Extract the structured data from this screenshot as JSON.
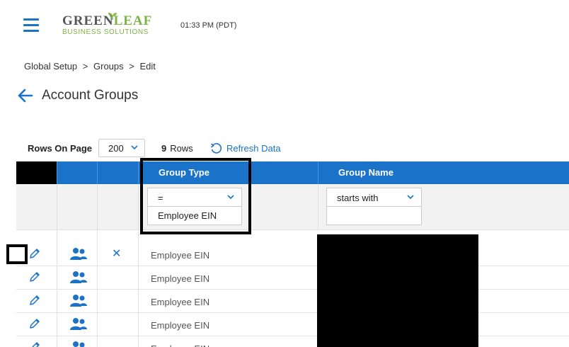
{
  "header": {
    "menu_icon": "hamburger-icon",
    "logo": {
      "line1_a": "GREEN",
      "line1_b": "LEAF",
      "line2": "BUSINESS SOLUTIONS"
    },
    "time": "01:33 PM (PDT)"
  },
  "breadcrumb": [
    "Global Setup",
    ">",
    "Groups",
    ">",
    "Edit"
  ],
  "page": {
    "title": "Account Groups",
    "back_icon": "arrow-left-icon"
  },
  "controls": {
    "rows_on_page_label": "Rows On Page",
    "rows_on_page_value": "200",
    "row_count": "9",
    "row_count_label": "Rows",
    "refresh_label": "Refresh Data"
  },
  "table": {
    "columns": [
      "",
      "",
      "",
      "Group Type",
      "Group Name"
    ],
    "filters": {
      "group_type_operator": "=",
      "group_type_value": "Employee EIN",
      "group_name_operator": "starts with",
      "group_name_value": ""
    },
    "rows": [
      {
        "group_type": "Employee EIN"
      },
      {
        "group_type": "Employee EIN"
      },
      {
        "group_type": "Employee EIN"
      },
      {
        "group_type": "Employee EIN"
      },
      {
        "group_type": "Employee EIN"
      }
    ]
  },
  "colors": {
    "accent": "#1a73c8",
    "brand_green": "#7cb342"
  }
}
